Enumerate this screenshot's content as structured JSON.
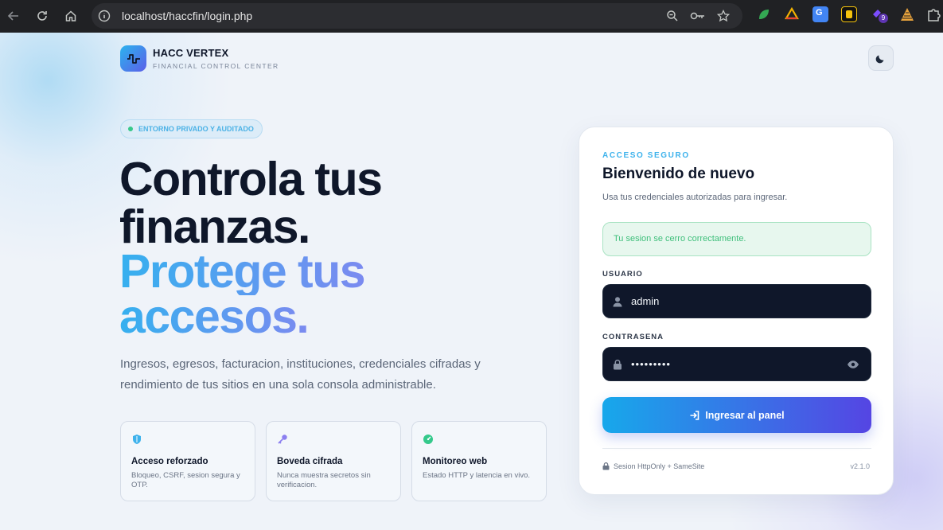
{
  "browser": {
    "url": "localhost/haccfin/login.php",
    "extension_badge": "9"
  },
  "brand": {
    "name": "HACC VERTEX",
    "tagline": "FINANCIAL CONTROL CENTER"
  },
  "hero": {
    "pill": "ENTORNO PRIVADO Y AUDITADO",
    "line1": "Controla tus",
    "line2": "finanzas.",
    "line3": "Protege tus",
    "line4": "accesos.",
    "description": "Ingresos, egresos, facturacion, instituciones, credenciales cifradas y rendimiento de tus sitios en una sola consola administrable."
  },
  "features": [
    {
      "icon": "shield-icon",
      "title": "Acceso reforzado",
      "text": "Bloqueo, CSRF, sesion segura y OTP."
    },
    {
      "icon": "key-icon",
      "title": "Boveda cifrada",
      "text": "Nunca muestra secretos sin verificacion."
    },
    {
      "icon": "gauge-icon",
      "title": "Monitoreo web",
      "text": "Estado HTTP y latencia en vivo."
    }
  ],
  "login": {
    "eyebrow": "ACCESO SEGURO",
    "title": "Bienvenido de nuevo",
    "subtitle": "Usa tus credenciales autorizadas para ingresar.",
    "alert": "Tu sesion se cerro correctamente.",
    "username_label": "USUARIO",
    "username_value": "admin",
    "password_label": "CONTRASENA",
    "password_value": "•••••••••",
    "submit_label": "Ingresar al panel",
    "footer_note": "Sesion HttpOnly + SameSite",
    "version": "v2.1.0"
  },
  "colors": {
    "accent_start": "#17a8eb",
    "accent_end": "#5545e3",
    "success": "#3fbf7b",
    "dark": "#0f172a"
  }
}
